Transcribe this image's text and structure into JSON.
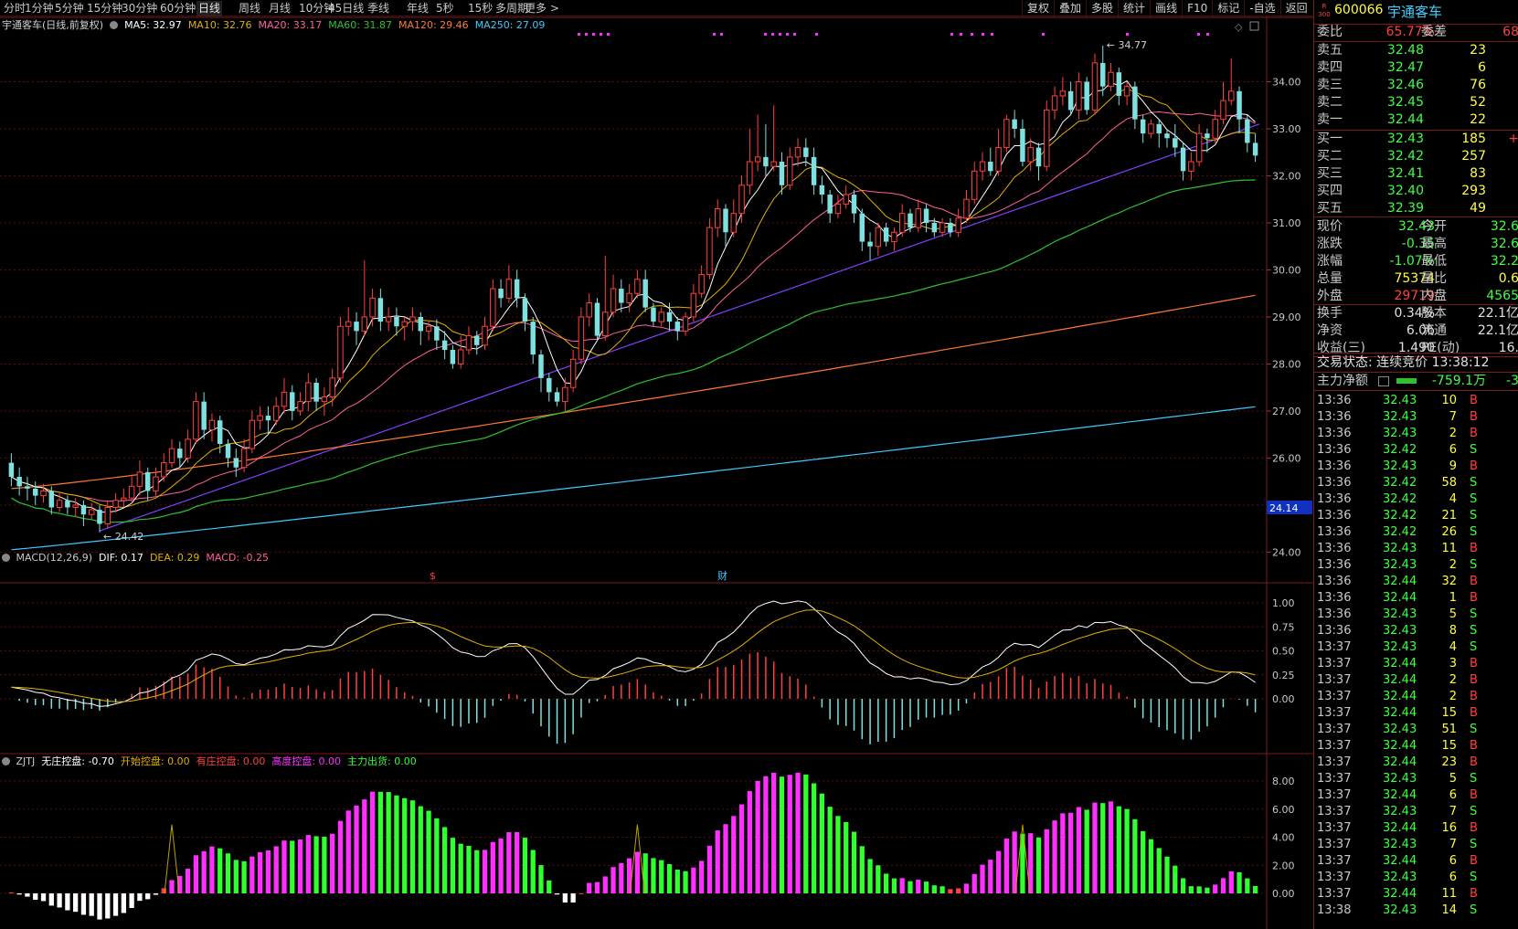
{
  "toolbar": {
    "periods": [
      "分时",
      "1分钟",
      "5分钟",
      "15分钟",
      "30分钟",
      "60分钟",
      "日线",
      "周线",
      "月线",
      "10分钟",
      "45日线",
      "季线",
      "年线",
      "5秒",
      "15秒",
      "多周期",
      "更多 >"
    ],
    "active": "日线",
    "right_buttons": [
      "复权",
      "叠加",
      "多股",
      "统计",
      "画线",
      "F10",
      "标记",
      "-自选",
      "返回"
    ]
  },
  "colors": {
    "up": "#ff4040",
    "down": "#7fe0e0",
    "ma5": "#ffffff",
    "ma10": "#e0b000",
    "ma20": "#ff60a0",
    "ma60": "#30c030",
    "ma120": "#ff7830",
    "ma250": "#40c8ff",
    "trend": "#8040ff",
    "magenta": "#ff30ff",
    "green": "#30ff30"
  },
  "main_chart": {
    "title": "宇通客车(日线,前复权)",
    "ma": [
      {
        "label": "MA5: 32.97",
        "color": "#ffffff"
      },
      {
        "label": "MA10: 32.76",
        "color": "#e0b000"
      },
      {
        "label": "MA20: 33.17",
        "color": "#ff60a0"
      },
      {
        "label": "MA60: 31.87",
        "color": "#30c030"
      },
      {
        "label": "MA120: 29.46",
        "color": "#ff7830"
      },
      {
        "label": "MA250: 27.09",
        "color": "#40c8ff"
      }
    ],
    "y_ticks": [
      "34.00",
      "33.00",
      "32.00",
      "31.00",
      "30.00",
      "29.00",
      "28.00",
      "27.00",
      "26.00",
      "25.00",
      "24.00"
    ],
    "high_label": "34.77",
    "low_label": "24.42",
    "current_price_tag": "24.14",
    "marks": [
      "$",
      "财"
    ]
  },
  "macd": {
    "labels": [
      {
        "text": "MACD(12,26,9)",
        "color": "#c8c8c8"
      },
      {
        "text": "DIF: 0.17",
        "color": "#ffffff"
      },
      {
        "text": "DEA: 0.29",
        "color": "#e0b000"
      },
      {
        "text": "MACD: -0.25",
        "color": "#ff60a0"
      }
    ],
    "y_ticks": [
      "1.00",
      "0.75",
      "0.50",
      "0.25",
      "0.00"
    ]
  },
  "zjtj": {
    "labels": [
      {
        "text": "ZJTJ",
        "color": "#c8c8c8"
      },
      {
        "text": "无庄控盘: -0.70",
        "color": "#ffffff"
      },
      {
        "text": "开始控盘: 0.00",
        "color": "#e0b000"
      },
      {
        "text": "有庄控盘: 0.00",
        "color": "#ff4040"
      },
      {
        "text": "高度控盘: 0.00",
        "color": "#ff30ff"
      },
      {
        "text": "主力出货: 0.00",
        "color": "#30ff30"
      }
    ],
    "y_ticks": [
      "8.00",
      "6.00",
      "4.00",
      "2.00",
      "0.00"
    ]
  },
  "chart_data": {
    "type": "candlestick",
    "ylim": [
      23.6,
      35.0
    ],
    "candles": [
      [
        25.9,
        25.6,
        26.1,
        25.4
      ],
      [
        25.6,
        25.4,
        25.8,
        25.2
      ],
      [
        25.4,
        25.35,
        25.6,
        25.1
      ],
      [
        25.35,
        25.2,
        25.5,
        25.0
      ],
      [
        25.2,
        25.3,
        25.45,
        25.05
      ],
      [
        25.3,
        24.95,
        25.4,
        24.8
      ],
      [
        24.95,
        25.1,
        25.25,
        24.85
      ],
      [
        25.1,
        24.95,
        25.2,
        24.8
      ],
      [
        24.95,
        25.0,
        25.15,
        24.75
      ],
      [
        25.0,
        24.8,
        25.1,
        24.55
      ],
      [
        24.8,
        24.9,
        25.05,
        24.7
      ],
      [
        24.9,
        24.6,
        25.0,
        24.42
      ],
      [
        24.6,
        24.95,
        25.1,
        24.5
      ],
      [
        24.95,
        25.1,
        25.25,
        24.85
      ],
      [
        25.1,
        25.15,
        25.35,
        24.95
      ],
      [
        25.15,
        25.4,
        25.65,
        25.05
      ],
      [
        25.4,
        25.7,
        25.95,
        25.2
      ],
      [
        25.7,
        25.3,
        25.8,
        25.1
      ],
      [
        25.3,
        25.6,
        25.8,
        25.2
      ],
      [
        25.6,
        25.9,
        26.1,
        25.5
      ],
      [
        25.9,
        26.2,
        26.4,
        25.8
      ],
      [
        26.2,
        26.0,
        26.35,
        25.8
      ],
      [
        26.0,
        26.4,
        26.6,
        25.9
      ],
      [
        26.4,
        27.2,
        27.4,
        26.3
      ],
      [
        27.2,
        26.6,
        27.4,
        26.4
      ],
      [
        26.6,
        26.8,
        26.95,
        26.35
      ],
      [
        26.8,
        26.3,
        26.9,
        26.1
      ],
      [
        26.3,
        26.0,
        26.4,
        25.8
      ],
      [
        26.0,
        25.8,
        26.2,
        25.6
      ],
      [
        25.8,
        26.2,
        26.4,
        25.7
      ],
      [
        26.2,
        26.8,
        27.0,
        26.1
      ],
      [
        26.8,
        26.9,
        27.1,
        26.6
      ],
      [
        26.9,
        26.8,
        27.1,
        26.5
      ],
      [
        26.8,
        27.1,
        27.3,
        26.7
      ],
      [
        27.1,
        27.4,
        27.7,
        26.95
      ],
      [
        27.4,
        27.0,
        27.55,
        26.8
      ],
      [
        27.0,
        27.2,
        27.4,
        26.9
      ],
      [
        27.2,
        27.6,
        27.8,
        27.0
      ],
      [
        27.6,
        27.2,
        27.7,
        27.0
      ],
      [
        27.2,
        27.3,
        27.5,
        26.9
      ],
      [
        27.3,
        27.7,
        27.9,
        27.1
      ],
      [
        27.7,
        28.8,
        29.0,
        27.6
      ],
      [
        28.8,
        28.9,
        29.2,
        28.6
      ],
      [
        28.9,
        28.7,
        29.1,
        28.4
      ],
      [
        28.7,
        29.0,
        30.2,
        28.6
      ],
      [
        29.0,
        29.4,
        29.6,
        28.8
      ],
      [
        29.4,
        28.9,
        29.6,
        28.7
      ],
      [
        28.9,
        29.0,
        29.2,
        28.7
      ],
      [
        29.0,
        28.8,
        29.2,
        28.6
      ],
      [
        28.8,
        28.9,
        29.0,
        28.5
      ],
      [
        28.9,
        29.0,
        29.2,
        28.7
      ],
      [
        29.0,
        28.7,
        29.1,
        28.4
      ],
      [
        28.7,
        28.8,
        28.9,
        28.5
      ],
      [
        28.8,
        28.5,
        28.95,
        28.3
      ],
      [
        28.5,
        28.3,
        28.7,
        28.1
      ],
      [
        28.3,
        28.0,
        28.4,
        27.9
      ],
      [
        28.0,
        28.3,
        28.6,
        27.9
      ],
      [
        28.3,
        28.6,
        28.8,
        28.2
      ],
      [
        28.6,
        28.4,
        28.7,
        28.2
      ],
      [
        28.4,
        28.8,
        29.0,
        28.3
      ],
      [
        28.8,
        29.6,
        29.8,
        28.7
      ],
      [
        29.6,
        29.4,
        29.8,
        29.2
      ],
      [
        29.4,
        29.8,
        30.1,
        29.3
      ],
      [
        29.8,
        29.4,
        30.0,
        29.2
      ],
      [
        29.4,
        28.9,
        29.5,
        28.7
      ],
      [
        28.9,
        28.2,
        29.0,
        28.0
      ],
      [
        28.2,
        27.7,
        28.3,
        27.4
      ],
      [
        27.7,
        27.4,
        27.8,
        27.2
      ],
      [
        27.4,
        27.2,
        27.5,
        27.1
      ],
      [
        27.2,
        27.5,
        27.7,
        27.0
      ],
      [
        27.5,
        28.1,
        28.3,
        27.4
      ],
      [
        28.1,
        29.0,
        29.2,
        28.0
      ],
      [
        29.0,
        29.3,
        29.5,
        28.8
      ],
      [
        29.3,
        28.6,
        29.4,
        28.5
      ],
      [
        28.6,
        29.1,
        30.3,
        28.5
      ],
      [
        29.1,
        29.6,
        29.9,
        29.0
      ],
      [
        29.6,
        29.3,
        29.8,
        29.1
      ],
      [
        29.3,
        29.5,
        29.7,
        29.1
      ],
      [
        29.5,
        29.8,
        30.0,
        29.4
      ],
      [
        29.8,
        29.2,
        30.0,
        29.1
      ],
      [
        29.2,
        28.9,
        29.3,
        28.8
      ],
      [
        28.9,
        29.1,
        29.2,
        28.8
      ],
      [
        29.1,
        28.9,
        29.3,
        28.7
      ],
      [
        28.9,
        28.7,
        29.0,
        28.5
      ],
      [
        28.7,
        29.0,
        29.1,
        28.6
      ],
      [
        29.0,
        29.5,
        29.7,
        28.9
      ],
      [
        29.5,
        29.9,
        30.1,
        29.4
      ],
      [
        29.9,
        30.9,
        31.1,
        29.8
      ],
      [
        30.9,
        31.3,
        31.5,
        30.7
      ],
      [
        31.3,
        30.8,
        31.4,
        30.5
      ],
      [
        30.8,
        31.2,
        31.5,
        30.7
      ],
      [
        31.2,
        31.8,
        32.0,
        31.0
      ],
      [
        31.8,
        32.3,
        33.0,
        31.6
      ],
      [
        32.3,
        32.4,
        33.3,
        32.1
      ],
      [
        32.4,
        32.2,
        33.1,
        32.0
      ],
      [
        32.2,
        32.3,
        33.5,
        32.1
      ],
      [
        32.3,
        31.8,
        32.5,
        31.6
      ],
      [
        31.8,
        32.4,
        32.6,
        31.7
      ],
      [
        32.4,
        32.6,
        32.8,
        32.2
      ],
      [
        32.6,
        32.4,
        32.8,
        32.2
      ],
      [
        32.4,
        31.8,
        32.6,
        31.6
      ],
      [
        31.8,
        31.6,
        32.0,
        31.4
      ],
      [
        31.6,
        31.2,
        31.7,
        31.0
      ],
      [
        31.2,
        31.4,
        31.6,
        31.1
      ],
      [
        31.4,
        31.6,
        31.8,
        31.3
      ],
      [
        31.6,
        31.2,
        31.7,
        31.0
      ],
      [
        31.2,
        30.6,
        31.3,
        30.4
      ],
      [
        30.6,
        30.5,
        30.8,
        30.2
      ],
      [
        30.5,
        30.9,
        31.0,
        30.3
      ],
      [
        30.9,
        30.6,
        31.0,
        30.5
      ],
      [
        30.6,
        30.8,
        30.9,
        30.4
      ],
      [
        30.8,
        31.2,
        31.4,
        30.7
      ],
      [
        31.2,
        30.9,
        31.3,
        30.8
      ],
      [
        30.9,
        31.3,
        31.5,
        30.8
      ],
      [
        31.3,
        31.0,
        31.4,
        30.8
      ],
      [
        31.0,
        30.8,
        31.1,
        30.7
      ],
      [
        30.8,
        31.0,
        31.1,
        30.7
      ],
      [
        31.0,
        30.8,
        31.1,
        30.7
      ],
      [
        30.8,
        31.1,
        31.3,
        30.7
      ],
      [
        31.1,
        31.5,
        31.7,
        31.0
      ],
      [
        31.5,
        32.1,
        32.3,
        31.4
      ],
      [
        32.1,
        32.3,
        32.5,
        31.9
      ],
      [
        32.3,
        32.1,
        32.6,
        32.0
      ],
      [
        32.1,
        32.6,
        33.0,
        32.0
      ],
      [
        32.6,
        33.2,
        33.3,
        32.5
      ],
      [
        33.2,
        33.0,
        33.4,
        32.8
      ],
      [
        33.0,
        32.3,
        33.2,
        32.2
      ],
      [
        32.3,
        32.6,
        32.8,
        32.1
      ],
      [
        32.6,
        32.2,
        32.7,
        31.9
      ],
      [
        32.2,
        33.4,
        33.6,
        32.1
      ],
      [
        33.4,
        33.7,
        33.9,
        33.2
      ],
      [
        33.7,
        33.8,
        34.1,
        33.5
      ],
      [
        33.8,
        33.4,
        34.0,
        33.3
      ],
      [
        33.4,
        34.0,
        34.2,
        33.2
      ],
      [
        34.0,
        33.4,
        34.1,
        33.3
      ],
      [
        33.4,
        34.4,
        34.6,
        33.3
      ],
      [
        34.4,
        33.9,
        34.77,
        33.7
      ],
      [
        33.9,
        34.2,
        34.4,
        33.8
      ],
      [
        34.2,
        33.7,
        34.3,
        33.5
      ],
      [
        33.7,
        33.9,
        34.0,
        33.5
      ],
      [
        33.9,
        33.2,
        34.0,
        33.0
      ],
      [
        33.2,
        32.9,
        33.3,
        32.7
      ],
      [
        32.9,
        33.1,
        33.2,
        32.8
      ],
      [
        33.1,
        32.9,
        33.2,
        32.6
      ],
      [
        32.9,
        32.8,
        33.0,
        32.6
      ],
      [
        32.8,
        32.6,
        33.1,
        32.4
      ],
      [
        32.6,
        32.1,
        32.7,
        31.9
      ],
      [
        32.1,
        32.3,
        32.5,
        31.9
      ],
      [
        32.3,
        32.9,
        33.1,
        32.2
      ],
      [
        32.9,
        32.8,
        33.0,
        32.5
      ],
      [
        32.8,
        33.2,
        33.4,
        32.7
      ],
      [
        33.2,
        33.6,
        34.0,
        33.1
      ],
      [
        33.6,
        33.8,
        34.5,
        33.5
      ],
      [
        33.8,
        33.2,
        33.9,
        32.9
      ],
      [
        33.2,
        32.7,
        33.3,
        32.5
      ],
      [
        32.7,
        32.43,
        32.9,
        32.3
      ]
    ]
  },
  "quote": {
    "market_badge": "R 300",
    "code": "600066",
    "name": "宇通客车",
    "weibi_label": "委比",
    "weibi": "65.77%",
    "weicha_label": "委差",
    "weicha": "68",
    "sell": [
      {
        "label": "卖五",
        "price": "32.48",
        "vol": "23"
      },
      {
        "label": "卖四",
        "price": "32.47",
        "vol": "6"
      },
      {
        "label": "卖三",
        "price": "32.46",
        "vol": "76"
      },
      {
        "label": "卖二",
        "price": "32.45",
        "vol": "52"
      },
      {
        "label": "卖一",
        "price": "32.44",
        "vol": "22"
      }
    ],
    "buy": [
      {
        "label": "买一",
        "price": "32.43",
        "vol": "185",
        "extra": "+"
      },
      {
        "label": "买二",
        "price": "32.42",
        "vol": "257",
        "extra": ""
      },
      {
        "label": "买三",
        "price": "32.41",
        "vol": "83",
        "extra": ""
      },
      {
        "label": "买四",
        "price": "32.40",
        "vol": "293",
        "extra": ""
      },
      {
        "label": "买五",
        "price": "32.39",
        "vol": "49",
        "extra": ""
      }
    ],
    "stats": [
      {
        "k1": "现价",
        "v1": "32.43",
        "c1": "g",
        "k2": "今开",
        "v2": "32.6",
        "c2": "g"
      },
      {
        "k1": "涨跌",
        "v1": "-0.35",
        "c1": "g",
        "k2": "最高",
        "v2": "32.6",
        "c2": "g"
      },
      {
        "k1": "涨幅",
        "v1": "-1.07%",
        "c1": "g",
        "k2": "最低",
        "v2": "32.2",
        "c2": "g"
      },
      {
        "k1": "总量",
        "v1": "75374",
        "c1": "y",
        "k2": "量比",
        "v2": "0.6",
        "c2": "y"
      },
      {
        "k1": "外盘",
        "v1": "29719",
        "c1": "r",
        "k2": "内盘",
        "v2": "4565",
        "c2": "g"
      },
      {
        "k1": "换手",
        "v1": "0.34%",
        "c1": "w",
        "k2": "股本",
        "v2": "22.1亿",
        "c2": "w"
      },
      {
        "k1": "净资",
        "v1": "6.06",
        "c1": "w",
        "k2": "流通",
        "v2": "22.1亿",
        "c2": "w"
      },
      {
        "k1": "收益(三)",
        "v1": "1.490",
        "c1": "w",
        "k2": "PE(动)",
        "v2": "16.",
        "c2": "w"
      }
    ],
    "trade_state": "交易状态: 连续竞价 13:38:12",
    "main_net_label": "主力净额",
    "main_net_value": "-759.1万",
    "main_net_extra": "-3",
    "trades": [
      {
        "t": "13:36",
        "p": "32.43",
        "v": "10",
        "bs": "B"
      },
      {
        "t": "13:36",
        "p": "32.43",
        "v": "7",
        "bs": "B"
      },
      {
        "t": "13:36",
        "p": "32.43",
        "v": "2",
        "bs": "B"
      },
      {
        "t": "13:36",
        "p": "32.42",
        "v": "6",
        "bs": "S"
      },
      {
        "t": "13:36",
        "p": "32.43",
        "v": "9",
        "bs": "B"
      },
      {
        "t": "13:36",
        "p": "32.42",
        "v": "58",
        "bs": "S"
      },
      {
        "t": "13:36",
        "p": "32.42",
        "v": "4",
        "bs": "S"
      },
      {
        "t": "13:36",
        "p": "32.42",
        "v": "21",
        "bs": "S"
      },
      {
        "t": "13:36",
        "p": "32.42",
        "v": "26",
        "bs": "S"
      },
      {
        "t": "13:36",
        "p": "32.43",
        "v": "11",
        "bs": "B"
      },
      {
        "t": "13:36",
        "p": "32.43",
        "v": "2",
        "bs": "S"
      },
      {
        "t": "13:36",
        "p": "32.44",
        "v": "32",
        "bs": "B"
      },
      {
        "t": "13:36",
        "p": "32.44",
        "v": "1",
        "bs": "B"
      },
      {
        "t": "13:36",
        "p": "32.43",
        "v": "5",
        "bs": "S"
      },
      {
        "t": "13:36",
        "p": "32.43",
        "v": "8",
        "bs": "S"
      },
      {
        "t": "13:37",
        "p": "32.43",
        "v": "4",
        "bs": "S"
      },
      {
        "t": "13:37",
        "p": "32.44",
        "v": "3",
        "bs": "B"
      },
      {
        "t": "13:37",
        "p": "32.44",
        "v": "2",
        "bs": "B"
      },
      {
        "t": "13:37",
        "p": "32.44",
        "v": "2",
        "bs": "B"
      },
      {
        "t": "13:37",
        "p": "32.44",
        "v": "15",
        "bs": "B"
      },
      {
        "t": "13:37",
        "p": "32.43",
        "v": "51",
        "bs": "S"
      },
      {
        "t": "13:37",
        "p": "32.44",
        "v": "15",
        "bs": "B"
      },
      {
        "t": "13:37",
        "p": "32.44",
        "v": "23",
        "bs": "B"
      },
      {
        "t": "13:37",
        "p": "32.43",
        "v": "5",
        "bs": "S"
      },
      {
        "t": "13:37",
        "p": "32.44",
        "v": "6",
        "bs": "B"
      },
      {
        "t": "13:37",
        "p": "32.43",
        "v": "7",
        "bs": "S"
      },
      {
        "t": "13:37",
        "p": "32.44",
        "v": "16",
        "bs": "B"
      },
      {
        "t": "13:37",
        "p": "32.43",
        "v": "7",
        "bs": "S"
      },
      {
        "t": "13:37",
        "p": "32.44",
        "v": "6",
        "bs": "B"
      },
      {
        "t": "13:37",
        "p": "32.43",
        "v": "6",
        "bs": "S"
      },
      {
        "t": "13:37",
        "p": "32.44",
        "v": "11",
        "bs": "B"
      },
      {
        "t": "13:38",
        "p": "32.43",
        "v": "14",
        "bs": "S"
      }
    ]
  }
}
